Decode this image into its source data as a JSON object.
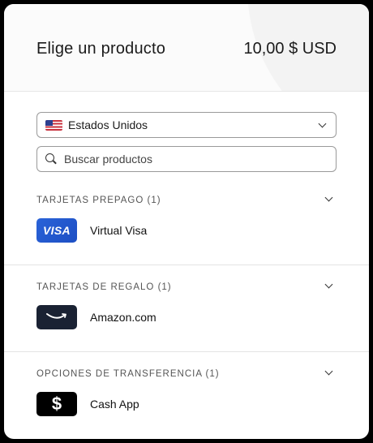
{
  "header": {
    "title": "Elige un producto",
    "price": "10,00 $ USD"
  },
  "country": {
    "selected": "Estados Unidos",
    "flag_icon": "us-flag-icon"
  },
  "search": {
    "placeholder": "Buscar productos",
    "value": ""
  },
  "sections": [
    {
      "title": "TARJETAS PREPAGO (1)",
      "items": [
        {
          "label": "Virtual Visa",
          "logo_text": "VISA",
          "icon": "visa-logo"
        }
      ]
    },
    {
      "title": "TARJETAS DE REGALO (1)",
      "items": [
        {
          "label": "Amazon.com",
          "icon": "amazon-logo"
        }
      ]
    },
    {
      "title": "OPCIONES DE TRANSFERENCIA (1)",
      "items": [
        {
          "label": "Cash App",
          "logo_text": "$",
          "icon": "cash-app-logo"
        }
      ]
    }
  ],
  "colors": {
    "visa_blue": "#2a63d8",
    "amazon_dark": "#1a2233",
    "amazon_orange": "#ff9900",
    "cashapp_black": "#000000"
  }
}
